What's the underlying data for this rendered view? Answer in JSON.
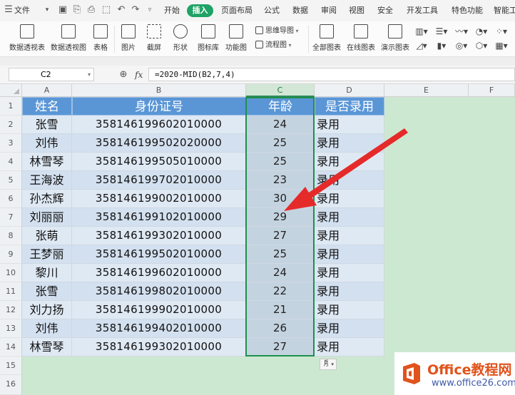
{
  "menubar": {
    "menu_label": "文件",
    "tabs": [
      "开始",
      "插入",
      "页面布局",
      "公式",
      "数据",
      "审阅",
      "视图",
      "安全",
      "开发工具",
      "特色功能",
      "智能工"
    ],
    "active_tab": "插入"
  },
  "ribbon": {
    "buttons": [
      "数据透视表",
      "数据透视图",
      "表格",
      "图片",
      "截屏",
      "形状",
      "图标库",
      "功能图",
      "全部图表",
      "在线图表",
      "演示图表"
    ],
    "small_items": [
      "思维导图",
      "流程图"
    ]
  },
  "formula_bar": {
    "cell_ref": "C2",
    "fx_label": "fx",
    "formula": "=2020-MID(B2,7,4)"
  },
  "sheet": {
    "col_headers": [
      "A",
      "B",
      "C",
      "D",
      "E",
      "F"
    ],
    "row_headers": [
      "1",
      "2",
      "3",
      "4",
      "5",
      "6",
      "7",
      "8",
      "9",
      "10",
      "11",
      "12",
      "13",
      "14",
      "15",
      "16"
    ],
    "table_headers": [
      "姓名",
      "身份证号",
      "年龄",
      "是否录用"
    ],
    "rows": [
      {
        "name": "张雪",
        "id": "358146199602010000",
        "age": "24",
        "status": "录用"
      },
      {
        "name": "刘伟",
        "id": "358146199502020000",
        "age": "25",
        "status": "录用"
      },
      {
        "name": "林雪琴",
        "id": "358146199505010000",
        "age": "25",
        "status": "录用"
      },
      {
        "name": "王海波",
        "id": "358146199702010000",
        "age": "23",
        "status": "录用"
      },
      {
        "name": "孙杰辉",
        "id": "358146199002010000",
        "age": "30",
        "status": "录用"
      },
      {
        "name": "刘丽丽",
        "id": "358146199102010000",
        "age": "29",
        "status": "录用"
      },
      {
        "name": "张萌",
        "id": "358146199302010000",
        "age": "27",
        "status": "录用"
      },
      {
        "name": "王梦丽",
        "id": "358146199502010000",
        "age": "25",
        "status": "录用"
      },
      {
        "name": "黎川",
        "id": "358146199602010000",
        "age": "24",
        "status": "录用"
      },
      {
        "name": "张雪",
        "id": "358146199802010000",
        "age": "22",
        "status": "录用"
      },
      {
        "name": "刘力扬",
        "id": "358146199902010000",
        "age": "21",
        "status": "录用"
      },
      {
        "name": "刘伟",
        "id": "358146199402010000",
        "age": "26",
        "status": "录用"
      },
      {
        "name": "林雪琴",
        "id": "358146199302010000",
        "age": "27",
        "status": "录用"
      }
    ],
    "paste_option": "㐆"
  },
  "watermark": {
    "title": "Office教程网",
    "url": "www.office26.com"
  },
  "colors": {
    "accent_green": "#1fa266",
    "header_blue": "#5a96d6",
    "arrow_red": "#e52a2a",
    "sheet_green": "#cde8d1"
  },
  "icons": [
    "menu-icon",
    "save-icon",
    "print-icon",
    "undo-icon",
    "redo-icon",
    "zoom-icon",
    "arrow-annotation"
  ]
}
